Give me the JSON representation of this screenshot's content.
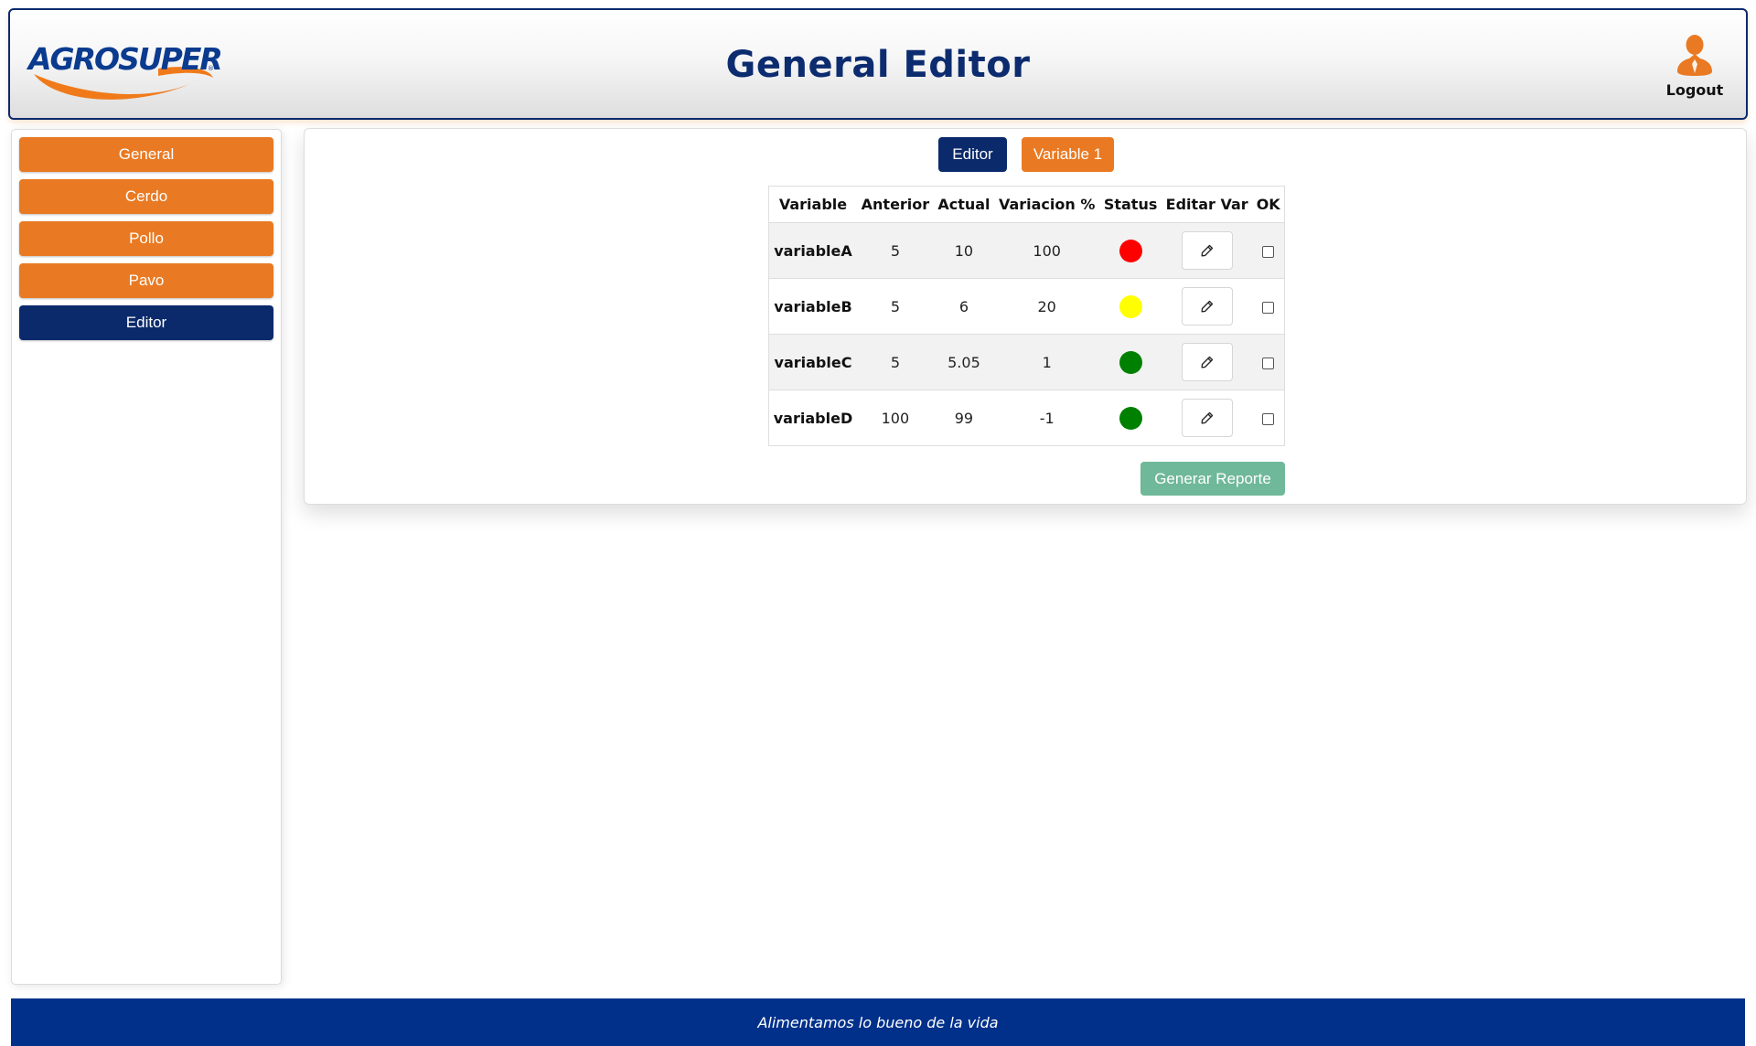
{
  "header": {
    "logo_text": "AGROSUPER",
    "title": "General Editor",
    "logout_label": "Logout",
    "logout_icon": "user-icon"
  },
  "sidebar": {
    "items": [
      {
        "label": "General",
        "active": false
      },
      {
        "label": "Cerdo",
        "active": false
      },
      {
        "label": "Pollo",
        "active": false
      },
      {
        "label": "Pavo",
        "active": false
      },
      {
        "label": "Editor",
        "active": true
      }
    ]
  },
  "main": {
    "tabs": [
      {
        "label": "Editor",
        "active": true
      },
      {
        "label": "Variable 1",
        "active": false
      }
    ],
    "table": {
      "columns": [
        "Variable",
        "Anterior",
        "Actual",
        "Variacion %",
        "Status",
        "Editar Var",
        "OK"
      ],
      "rows": [
        {
          "variable": "variableA",
          "anterior": "5",
          "actual": "10",
          "variacion": "100",
          "status": "red",
          "ok": false
        },
        {
          "variable": "variableB",
          "anterior": "5",
          "actual": "6",
          "variacion": "20",
          "status": "yellow",
          "ok": false
        },
        {
          "variable": "variableC",
          "anterior": "5",
          "actual": "5.05",
          "variacion": "1",
          "status": "green",
          "ok": false
        },
        {
          "variable": "variableD",
          "anterior": "100",
          "actual": "99",
          "variacion": "-1",
          "status": "green",
          "ok": false
        }
      ],
      "edit_icon": "pencil-icon"
    },
    "report_button_label": "Generar Reporte"
  },
  "footer": {
    "tagline": "Alimentamos lo bueno de la vida"
  },
  "colors": {
    "brand_orange": "#e97a23",
    "brand_navy": "#0b2a6b",
    "footer_blue": "#00308a",
    "report_green": "#6fb899",
    "status_red": "#ff0000",
    "status_yellow": "#ffff00",
    "status_green": "#008000"
  }
}
